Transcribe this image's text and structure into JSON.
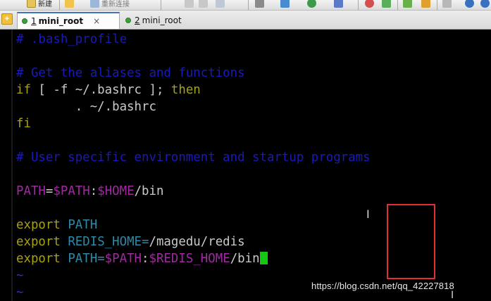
{
  "toolbar": {
    "new_label": "新建",
    "reconnect_label": "重新连接"
  },
  "tabs": [
    {
      "number": "1",
      "label": "mini_root",
      "close": "×"
    },
    {
      "number": "2",
      "label": "mini_root"
    }
  ],
  "terminal": {
    "lines": [
      {
        "text": "# .bash_profile"
      },
      {
        "text": "# Get the aliases and functions"
      },
      {
        "kw_if": "if",
        "text_test": " [ -f ~/.bashrc ]; ",
        "kw_then": "then"
      },
      {
        "text": "        . ~/.bashrc"
      },
      {
        "kw": "fi"
      },
      {
        "text": "# User specific environment and startup programs"
      },
      {
        "name": "PATH",
        "eq": "=",
        "var1": "$PATH",
        "colon": ":",
        "var2": "$HOME",
        "rest": "/bin"
      },
      {
        "kw": "export",
        "space": " ",
        "name": "PATH"
      },
      {
        "kw": "export",
        "space": " ",
        "name": "REDIS_HOME=",
        "rest": "/magedu/redis"
      },
      {
        "kw": "export",
        "space": " ",
        "name": "PATH=",
        "var1": "$PATH",
        "colon": ":",
        "var2": "$REDIS_HOME",
        "rest": "/bin"
      }
    ],
    "tilde": "~"
  },
  "watermark": "https://blog.csdn.net/qq_42227818",
  "colors": {
    "comment": "#1a1ab8",
    "keyword": "#a6a214",
    "variable": "#a02aa0",
    "identifier": "#2d8aa8",
    "cursor": "#14c814",
    "highlight_box": "#e03030"
  }
}
